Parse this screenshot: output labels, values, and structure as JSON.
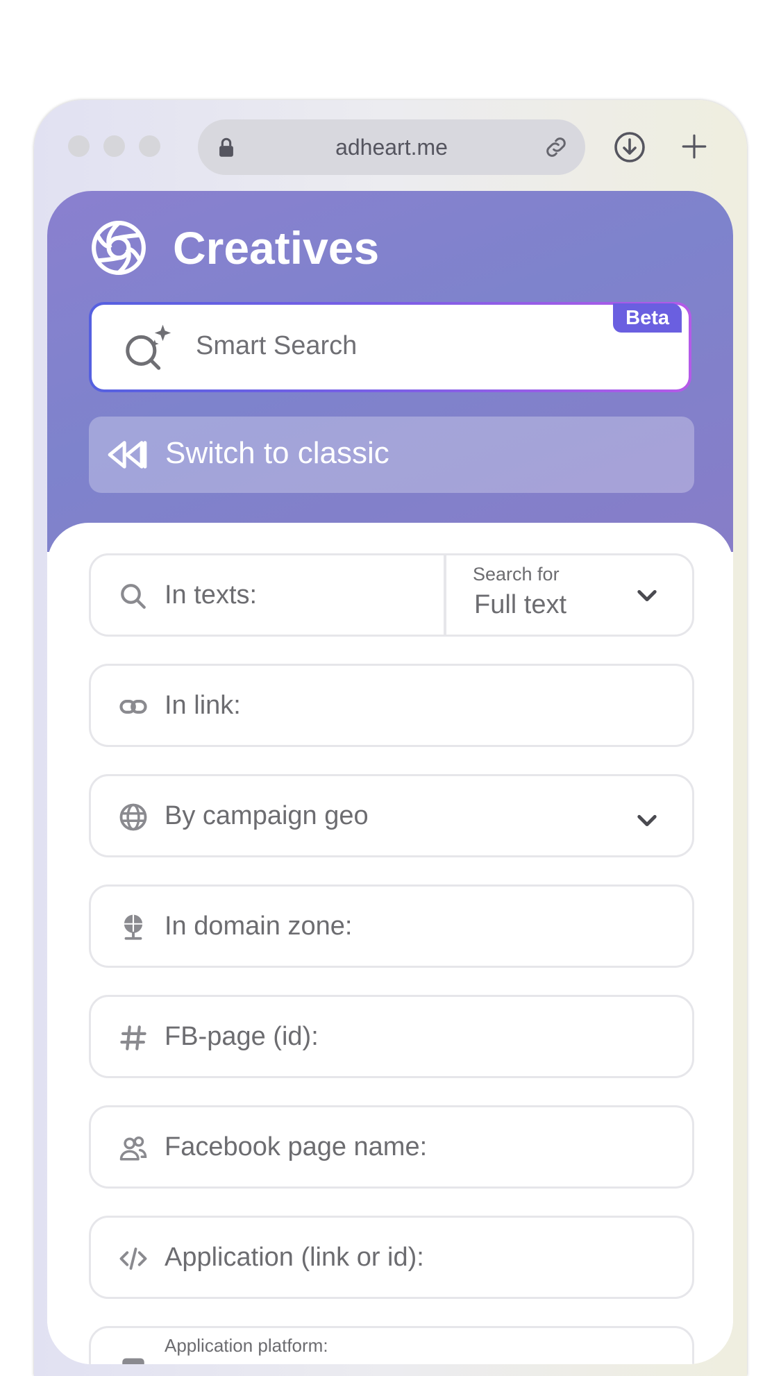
{
  "browser": {
    "url": "adheart.me"
  },
  "header": {
    "title": "Creatives"
  },
  "smart_search": {
    "placeholder": "Smart Search",
    "badge": "Beta"
  },
  "switch_classic": {
    "label": "Switch to classic"
  },
  "filters": {
    "in_texts": {
      "label": "In texts:",
      "search_for_label": "Search for",
      "search_for_value": "Full text"
    },
    "in_link": {
      "label": "In link:"
    },
    "campaign_geo": {
      "label": "By campaign geo"
    },
    "domain_zone": {
      "label": "In domain zone:"
    },
    "fb_page_id": {
      "label": "FB-page (id):"
    },
    "fb_page_name": {
      "label": "Facebook page name:"
    },
    "application": {
      "label": "Application (link or id):"
    },
    "app_platform": {
      "label": "Application platform:"
    }
  },
  "colors": {
    "accent": "#7e83cc",
    "beta_badge": "#6a5fe0",
    "field_border": "#e6e6ea",
    "label_text": "#6c6c70"
  },
  "icons": {
    "lock": "lock-icon",
    "link": "link-icon",
    "download": "download-icon",
    "new_tab": "plus-icon",
    "logo": "aperture-logo",
    "smart_search": "magnifier-sparkle-icon",
    "classic": "rewind-icon",
    "search": "search-icon",
    "chain": "link-icon",
    "globe": "globe-icon",
    "domain": "globe-stand-icon",
    "hash": "hash-icon",
    "users": "users-icon",
    "code": "code-icon",
    "platform": "device-icon"
  }
}
